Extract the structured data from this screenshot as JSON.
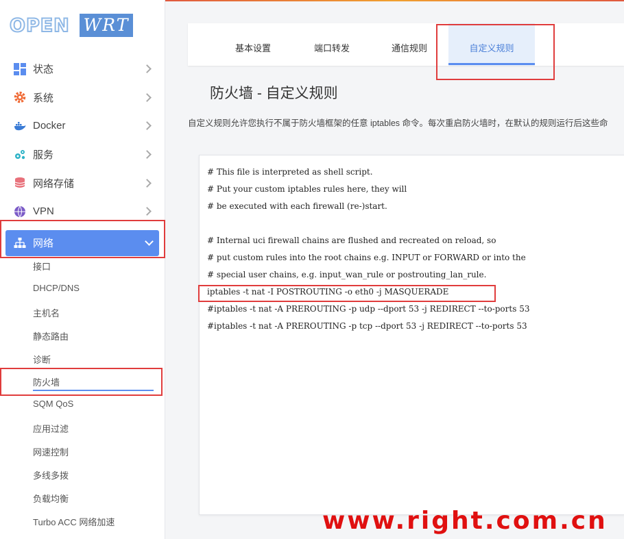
{
  "brand": {
    "logo_open": "OPEN",
    "logo_wrt": "WRT"
  },
  "sidebar": {
    "items": [
      {
        "label": "状态",
        "icon": "dashboard-icon"
      },
      {
        "label": "系统",
        "icon": "gear-icon"
      },
      {
        "label": "Docker",
        "icon": "docker-whale-icon"
      },
      {
        "label": "服务",
        "icon": "services-cogs-icon"
      },
      {
        "label": "网络存储",
        "icon": "database-icon"
      },
      {
        "label": "VPN",
        "icon": "vpn-icon"
      },
      {
        "label": "网络",
        "icon": "network-tree-icon"
      }
    ],
    "network_submenu": [
      "接口",
      "DHCP/DNS",
      "主机名",
      "静态路由",
      "诊断",
      "防火墙",
      "SQM QoS",
      "应用过滤",
      "网速控制",
      "多线多拨",
      "负载均衡",
      "Turbo ACC 网络加速"
    ]
  },
  "tabs": [
    "基本设置",
    "端口转发",
    "通信规则",
    "自定义规则"
  ],
  "page": {
    "title": "防火墙 - 自定义规则",
    "description": "自定义规则允许您执行不属于防火墙框架的任意 iptables 命令。每次重启防火墙时，在默认的规则运行后这些命"
  },
  "editor": {
    "lines": [
      "# This file is interpreted as shell script.",
      "# Put your custom iptables rules here, they will",
      "# be executed with each firewall (re-)start.",
      "",
      "# Internal uci firewall chains are flushed and recreated on reload, so",
      "# put custom rules into the root chains e.g. INPUT or FORWARD or into the",
      "# special user chains, e.g. input_wan_rule or postrouting_lan_rule.",
      "iptables -t nat -I POSTROUTING -o eth0 -j MASQUERADE",
      "#iptables -t nat -A PREROUTING -p udp --dport 53 -j REDIRECT --to-ports 53",
      "#iptables -t nat -A PREROUTING -p tcp --dport 53 -j REDIRECT --to-ports 53"
    ]
  },
  "watermark": "www.right.com.cn",
  "colors": {
    "accent": "#5b8def",
    "annotation": "#e03c3c",
    "watermark": "#e01010"
  }
}
